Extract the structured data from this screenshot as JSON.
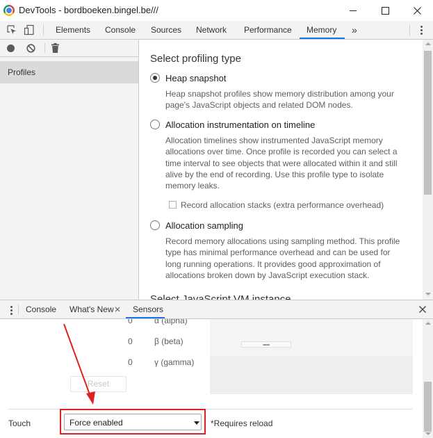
{
  "window": {
    "title": "DevTools - bordboeken.bingel.be///"
  },
  "main_tabs": [
    {
      "label": "Elements"
    },
    {
      "label": "Console"
    },
    {
      "label": "Sources"
    },
    {
      "label": "Network"
    },
    {
      "label": "Performance"
    },
    {
      "label": "Memory"
    }
  ],
  "more_tabs_label": "»",
  "active_tab": "Memory",
  "sidebar": {
    "items": [
      {
        "label": "Profiles"
      }
    ]
  },
  "memory": {
    "heading": "Select profiling type",
    "options": [
      {
        "label": "Heap snapshot",
        "checked": true,
        "description": "Heap snapshot profiles show memory distribution among your page's JavaScript objects and related DOM nodes."
      },
      {
        "label": "Allocation instrumentation on timeline",
        "checked": false,
        "description": "Allocation timelines show instrumented JavaScript memory allocations over time. Once profile is recorded you can select a time interval to see objects that were allocated within it and still alive by the end of recording. Use this profile type to isolate memory leaks.",
        "checkbox_label": "Record allocation stacks (extra performance overhead)"
      },
      {
        "label": "Allocation sampling",
        "checked": false,
        "description": "Record memory allocations using sampling method. This profile type has minimal performance overhead and can be used for long running operations. It provides good approximation of allocations broken down by JavaScript execution stack."
      }
    ],
    "heading2": "Select JavaScript VM instance"
  },
  "drawer": {
    "tabs": [
      {
        "label": "Console"
      },
      {
        "label": "What's New"
      },
      {
        "label": "Sensors"
      }
    ],
    "active_tab": "Sensors",
    "orientation": {
      "alpha": {
        "value": "0",
        "label": "α (alpha)"
      },
      "beta": {
        "value": "0",
        "label": "β (beta)"
      },
      "gamma": {
        "value": "0",
        "label": "γ (gamma)"
      }
    },
    "reset_label": "Reset",
    "touch": {
      "label": "Touch",
      "selected": "Force enabled",
      "note": "*Requires reload"
    }
  },
  "annotation": {
    "color": "#e0201c"
  }
}
